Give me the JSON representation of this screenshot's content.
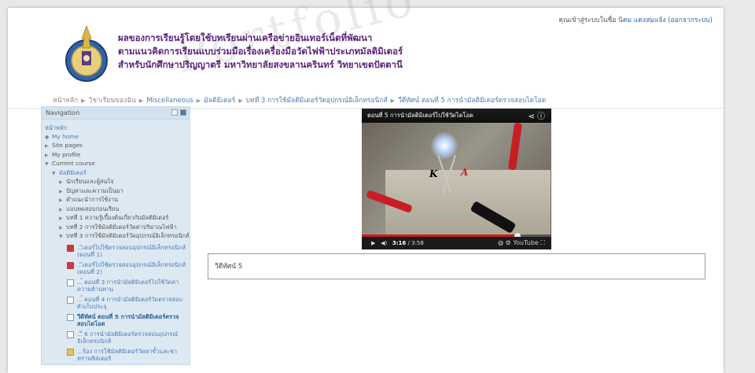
{
  "header": {
    "title_lines": [
      "ผลของการเรียนรู้โดยใช้บทเรียนผ่านเครือข่ายอินเทอร์เน็ตที่พัฒนา",
      "ตามแนวคิดการเรียนแบบร่วมมือเรื่องเครื่องมือวัดไฟฟ้าประเภทมัลติมิเตอร์",
      "สำหรับนักศึกษาปริญญาตรี มหาวิทยาลัยสงขลานครินทร์ วิทยาเขตปัตตานี"
    ],
    "login_prefix": "คุณเข้าสู่ระบบในชื่อ",
    "login_user": "นิคม แดงสมแจ้ง",
    "logout_label": "(ออกจากระบบ)",
    "logo_text": "Prince of Songkla University"
  },
  "breadcrumb": [
    "หน้าหลัก",
    "วิชาเรียนของฉัน",
    "Miscellaneous",
    "มัลติมิเตอร์",
    "บทที่ 3 การใช้มัลติมิเตอร์วัดอุปกรณ์อิเล็กทรอนิกส์",
    "วีดีทัศน์ ตอนที่ 5 การนำมัลติมิเตอร์ตรวจสอบไดโอด"
  ],
  "nav": {
    "title": "Navigation",
    "home": "หน้าหลัก",
    "my_home": "My home",
    "site_pages": "Site pages",
    "my_profile": "My profile",
    "current_course": "Current course",
    "course": "มัลติมิเตอร์",
    "sections": [
      "นักเรียนและผู้สนใจ",
      "ปัญหาและความเป็นมา",
      "คำแนะนำการใช้งาน",
      "แบบทดสอบก่อนเรียน",
      "บทที่ 1 ความรู้เบื้องต้นเกี่ยวกับมัลติมิเตอร์",
      "บทที่ 2 การใช้มัลติมิเตอร์วัดค่าปริมาณไฟฟ้า",
      "บทที่ 3 การใช้มัลติมิเตอร์วัดอุปกรณ์อิเล็กทรอนิกส์"
    ],
    "activities": [
      "...ิเตอร์ไปใช้ตรวจสอบอุปกรณ์อิเล็กทรอนิกส์ (ตอนที่ 1)",
      "...ิเตอร์ไปใช้ตรวจสอบอุปกรณ์อิเล็กทรอนิกส์ (ตอนที่ 2)",
      "...์ ตอนที่ 3 การนำมัลติมิเตอร์ไปใช้วัดค่าความต้านทาน",
      "...์ ตอนที่ 4 การนำมัลติมิเตอร์วัดตรวจสอบตัวเก็บประจุ",
      "วีดีทัศน์ ตอนที่ 5 การนำมัลติมิเตอร์ตรวจสอบไดโอด",
      "...ี่ 6 การนำมัลติมิเตอร์ตรวจสอบอุปกรณ์อิเล็กทรอนิกส์",
      "...ร้อง การใช้มัลติมิเตอร์วัดหาขั้วและชาทรานซิสเตอร์"
    ]
  },
  "video": {
    "title": "ตอนที่ 5 การนำมัลติมิเตอร์ไปใช้วัดไดโอด",
    "time_current": "3:16",
    "time_total": "3:58",
    "progress": 0.823,
    "label_k": "K",
    "label_a": "A",
    "youtube": "YouTube"
  },
  "content": {
    "caption": "วีดีทัศน์ 5"
  },
  "colors": {
    "title_purple": "#5b1f7a",
    "link_blue": "#4b7bb5",
    "nav_bg": "#dde9f2",
    "progress_red": "#cc181e"
  }
}
